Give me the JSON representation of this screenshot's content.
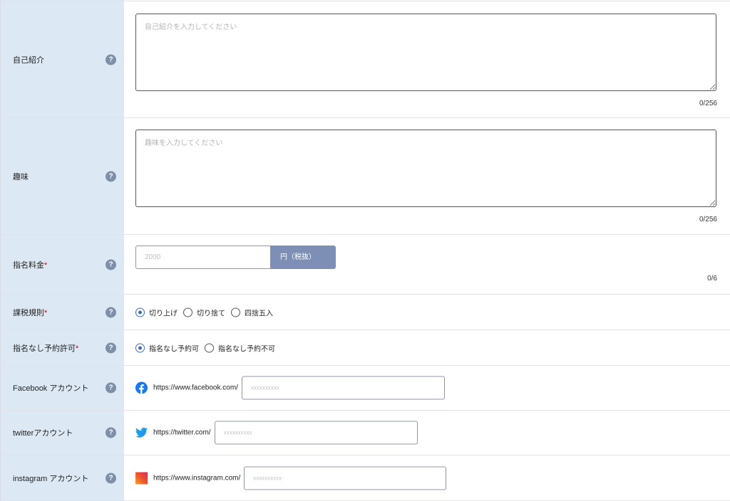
{
  "fields": {
    "intro": {
      "label": "自己紹介",
      "placeholder": "自己紹介を入力してください",
      "counter": "0/256"
    },
    "hobby": {
      "label": "趣味",
      "placeholder": "趣味を入力してください",
      "counter": "0/256"
    },
    "fee": {
      "label": "指名料金",
      "required_mark": "*",
      "placeholder": "2000",
      "unit": "円（税抜）",
      "counter": "0/6"
    },
    "tax_rule": {
      "label": "課税規則",
      "required_mark": "*",
      "options": [
        {
          "label": "切り上げ",
          "selected": true
        },
        {
          "label": "切り捨て",
          "selected": false
        },
        {
          "label": "四捨五入",
          "selected": false
        }
      ]
    },
    "no_nomination": {
      "label": "指名なし予約許可",
      "required_mark": "*",
      "options": [
        {
          "label": "指名なし予約可",
          "selected": true
        },
        {
          "label": "指名なし予約不可",
          "selected": false
        }
      ]
    },
    "facebook": {
      "label": "Facebook アカウント",
      "prefix": "https://www.facebook.com/",
      "placeholder": "xxxxxxxxxx",
      "icon": "facebook-icon",
      "color": "#1877f2"
    },
    "twitter": {
      "label": "twitterアカウント",
      "prefix": "https://twitter.com/",
      "placeholder": "xxxxxxxxxx",
      "icon": "twitter-icon",
      "color": "#1d9bf0"
    },
    "instagram": {
      "label": "instagram アカウント",
      "prefix": "https://www.instagram.com/",
      "placeholder": "xxxxxxxxxx",
      "icon": "instagram-icon",
      "color": "#f0542c"
    }
  },
  "help_glyph": "?"
}
